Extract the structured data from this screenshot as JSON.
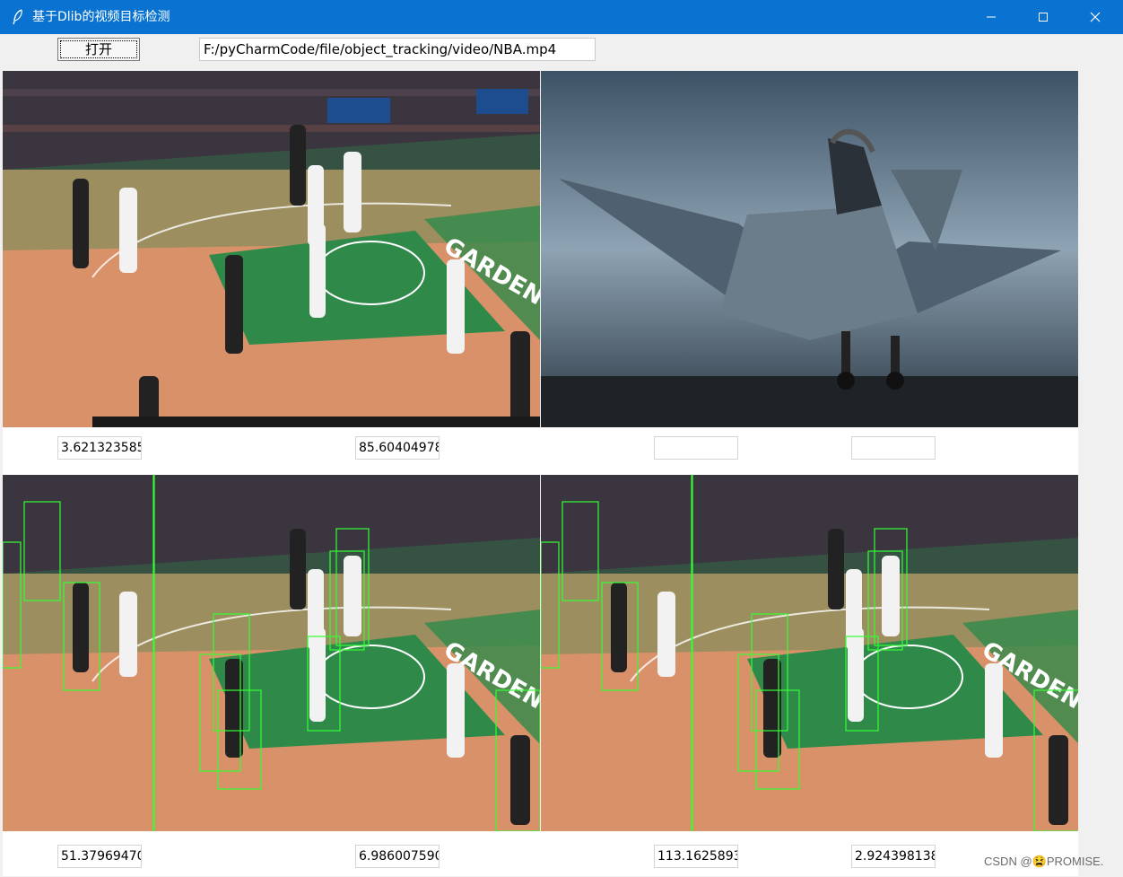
{
  "window": {
    "title": "基于Dlib的视频目标检测",
    "icon": "feather-icon",
    "controls": [
      "minimize-icon",
      "maximize-icon",
      "close-icon"
    ]
  },
  "toolbar": {
    "open_label": "打开",
    "path_value": "F:/pyCharmCode/file/object_tracking/video/NBA.mp4"
  },
  "panels": {
    "top_left": {
      "content": "basketball video frame"
    },
    "top_right": {
      "content": "fighter jet image"
    },
    "bottom_left": {
      "content": "basketball frame with green detection boxes"
    },
    "bottom_right": {
      "content": "basketball frame with green detection boxes"
    }
  },
  "fields": {
    "top_left_a": "3.621323585",
    "top_left_b": "85.60404978",
    "top_right_a": "",
    "top_right_b": "",
    "bottom_left_a": "51.37969470",
    "bottom_left_b": "6.986007590",
    "bottom_right_a": "113.1625893",
    "bottom_right_b": "2.924398138"
  },
  "watermark": "CSDN @😫PROMISE.",
  "colors": {
    "titlebar": "#0a73d1",
    "court": "#d9916a",
    "paint": "#2f8a4a",
    "detection_box": "#33ff33"
  }
}
